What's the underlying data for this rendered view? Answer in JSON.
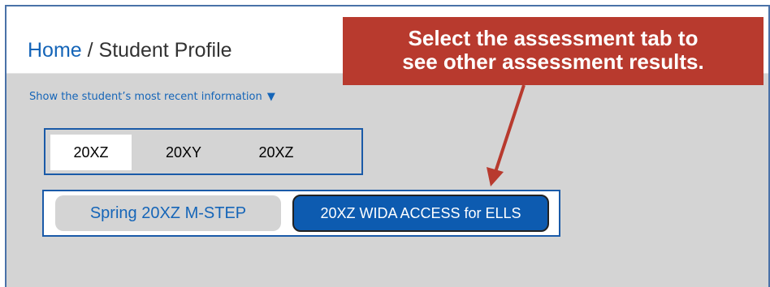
{
  "breadcrumb": {
    "home": "Home",
    "separator": "/",
    "current": "Student Profile"
  },
  "recent_info": {
    "label": "Show the student’s most recent information",
    "caret": "▼"
  },
  "year_tabs": [
    {
      "label": "20XZ",
      "active": true
    },
    {
      "label": "20XY",
      "active": false
    },
    {
      "label": "20XZ",
      "active": false
    }
  ],
  "assessment_tabs": [
    {
      "label": "Spring 20XZ M-STEP",
      "active": false
    },
    {
      "label": "20XZ WIDA ACCESS for ELLS",
      "active": true
    }
  ],
  "callout": {
    "line1": "Select the assessment tab to",
    "line2": "see other assessment results."
  },
  "colors": {
    "link": "#1565b8",
    "border": "#1a5aa8",
    "active_tab": "#0d5bb0",
    "callout_bg": "#b83a2e",
    "panel_bg": "#d4d4d4"
  },
  "icons": {
    "caret": "triangle-down-icon",
    "arrow": "callout-arrow-icon"
  }
}
